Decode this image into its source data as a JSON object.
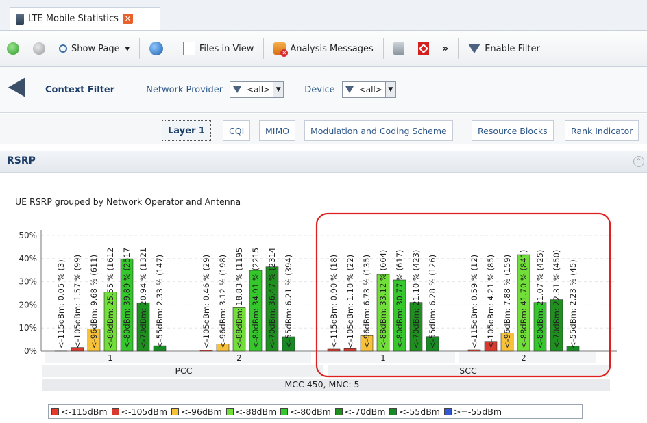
{
  "tab": {
    "title": "LTE Mobile Statistics",
    "close": "✕"
  },
  "toolbar": {
    "show_page": "Show Page",
    "files_in_view": "Files in View",
    "analysis_messages": "Analysis Messages",
    "more": "»",
    "enable_filter": "Enable Filter"
  },
  "context_filter": {
    "title": "Context Filter",
    "network_provider_label": "Network Provider",
    "network_provider_value": "<all>",
    "device_label": "Device",
    "device_value": "<all>"
  },
  "subtabs": [
    "Layer 1",
    "CQI",
    "MIMO",
    "Modulation and Coding Scheme",
    "Resource Blocks",
    "Rank Indicator"
  ],
  "section": {
    "title": "RSRP"
  },
  "chart_title": "UE RSRP grouped by Network Operator and Antenna",
  "colors": {
    "c115": "#e53a2a",
    "c105": "#d83a2f",
    "c96": "#f7c23a",
    "c88": "#71de3a",
    "c80": "#35c72c",
    "c70": "#1f8f1f",
    "c55": "#178a24",
    "c55p": "#3358d6"
  },
  "chart_data": {
    "type": "bar",
    "ylim": [
      0,
      50
    ],
    "yticks": [
      "0%",
      "10%",
      "20%",
      "30%",
      "40%",
      "50%"
    ],
    "outer_label": "MCC 450, MNC: 5",
    "groups": [
      {
        "name": "PCC",
        "antennas": [
          {
            "label": "1",
            "bars": [
              {
                "cat": "<-115dBm",
                "value": 0.05,
                "text": "<-115dBm: 0.05 % (3)"
              },
              {
                "cat": "<-105dBm",
                "value": 1.57,
                "text": "<-105dBm: 1.57 % (99)"
              },
              {
                "cat": "<-96dBm",
                "value": 9.68,
                "text": "<-96dBm: 9.68 % (611)"
              },
              {
                "cat": "<-88dBm",
                "value": 25.55,
                "text": "<-88dBm: 25.55 % (1612"
              },
              {
                "cat": "<-80dBm",
                "value": 39.89,
                "text": "<-80dBm: 39.89 % (2517"
              },
              {
                "cat": "<-70dBm",
                "value": 20.94,
                "text": "<-70dBm: 20.94 % (1321"
              },
              {
                "cat": "<-55dBm",
                "value": 2.33,
                "text": "<-55dBm: 2.33 % (147)"
              }
            ]
          },
          {
            "label": "2",
            "bars": [
              {
                "cat": "<-115dBm",
                "value": 0,
                "text": ""
              },
              {
                "cat": "<-105dBm",
                "value": 0.46,
                "text": "<-105dBm: 0.46 % (29)"
              },
              {
                "cat": "<-96dBm",
                "value": 3.12,
                "text": "<-96dBm: 3.12 % (198)"
              },
              {
                "cat": "<-88dBm",
                "value": 18.83,
                "text": "<-88dBm: 18.83 % (1195"
              },
              {
                "cat": "<-80dBm",
                "value": 34.91,
                "text": "<-80dBm: 34.91 % (2215"
              },
              {
                "cat": "<-70dBm",
                "value": 36.47,
                "text": "<-70dBm: 36.47 % (2314"
              },
              {
                "cat": "<-55dBm",
                "value": 6.21,
                "text": "<-55dBm: 6.21 % (394)"
              }
            ]
          }
        ]
      },
      {
        "name": "SCC",
        "antennas": [
          {
            "label": "1",
            "bars": [
              {
                "cat": "<-115dBm",
                "value": 0.9,
                "text": "<-115dBm: 0.90 % (18)"
              },
              {
                "cat": "<-105dBm",
                "value": 1.1,
                "text": "<-105dBm: 1.10 % (22)"
              },
              {
                "cat": "<-96dBm",
                "value": 6.73,
                "text": "<-96dBm: 6.73 % (135)"
              },
              {
                "cat": "<-88dBm",
                "value": 33.12,
                "text": "<-88dBm: 33.12 % (664)"
              },
              {
                "cat": "<-80dBm",
                "value": 30.77,
                "text": "<-80dBm: 30.77 % (617)"
              },
              {
                "cat": "<-70dBm",
                "value": 21.1,
                "text": "<-70dBm: 21.10 % (423)"
              },
              {
                "cat": "<-55dBm",
                "value": 6.28,
                "text": "<-55dBm: 6.28 % (126)"
              }
            ]
          },
          {
            "label": "2",
            "bars": [
              {
                "cat": "<-115dBm",
                "value": 0.59,
                "text": "<-115dBm: 0.59 % (12)"
              },
              {
                "cat": "<-105dBm",
                "value": 4.21,
                "text": "<-105dBm: 4.21 % (85)"
              },
              {
                "cat": "<-96dBm",
                "value": 7.88,
                "text": "<-96dBm: 7.88 % (159)"
              },
              {
                "cat": "<-88dBm",
                "value": 41.7,
                "text": "<-88dBm: 41.70 % (841)"
              },
              {
                "cat": "<-80dBm",
                "value": 21.07,
                "text": "<-80dBm: 21.07 % (425)"
              },
              {
                "cat": "<-70dBm",
                "value": 22.31,
                "text": "<-70dBm: 22.31 % (450)"
              },
              {
                "cat": "<-55dBm",
                "value": 2.23,
                "text": "<-55dBm: 2.23 % (45)"
              }
            ]
          }
        ]
      }
    ],
    "legend": [
      "<-115dBm",
      "<-105dBm",
      "<-96dBm",
      "<-88dBm",
      "<-80dBm",
      "<-70dBm",
      "<-55dBm",
      ">=-55dBm"
    ]
  }
}
